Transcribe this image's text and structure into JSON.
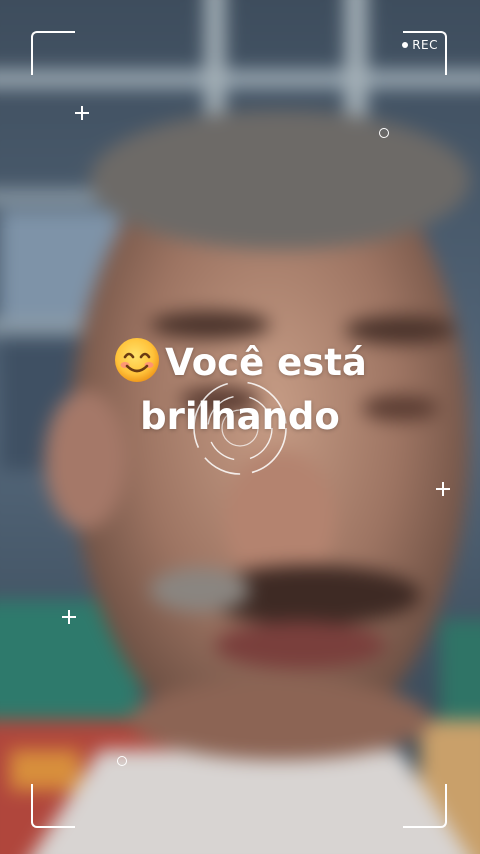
{
  "recording": {
    "label": "REC",
    "icon": "record-dot-icon"
  },
  "caption": {
    "emoji": "smiling-face-with-smiling-eyes-icon",
    "line1": "Você está",
    "line2": "brilhando"
  },
  "frame": {
    "corner_color": "#ffffff",
    "icons": [
      "frame-corner-icon",
      "sparkle-plus-icon",
      "sparkle-ring-icon",
      "focus-reticle-icon"
    ]
  }
}
